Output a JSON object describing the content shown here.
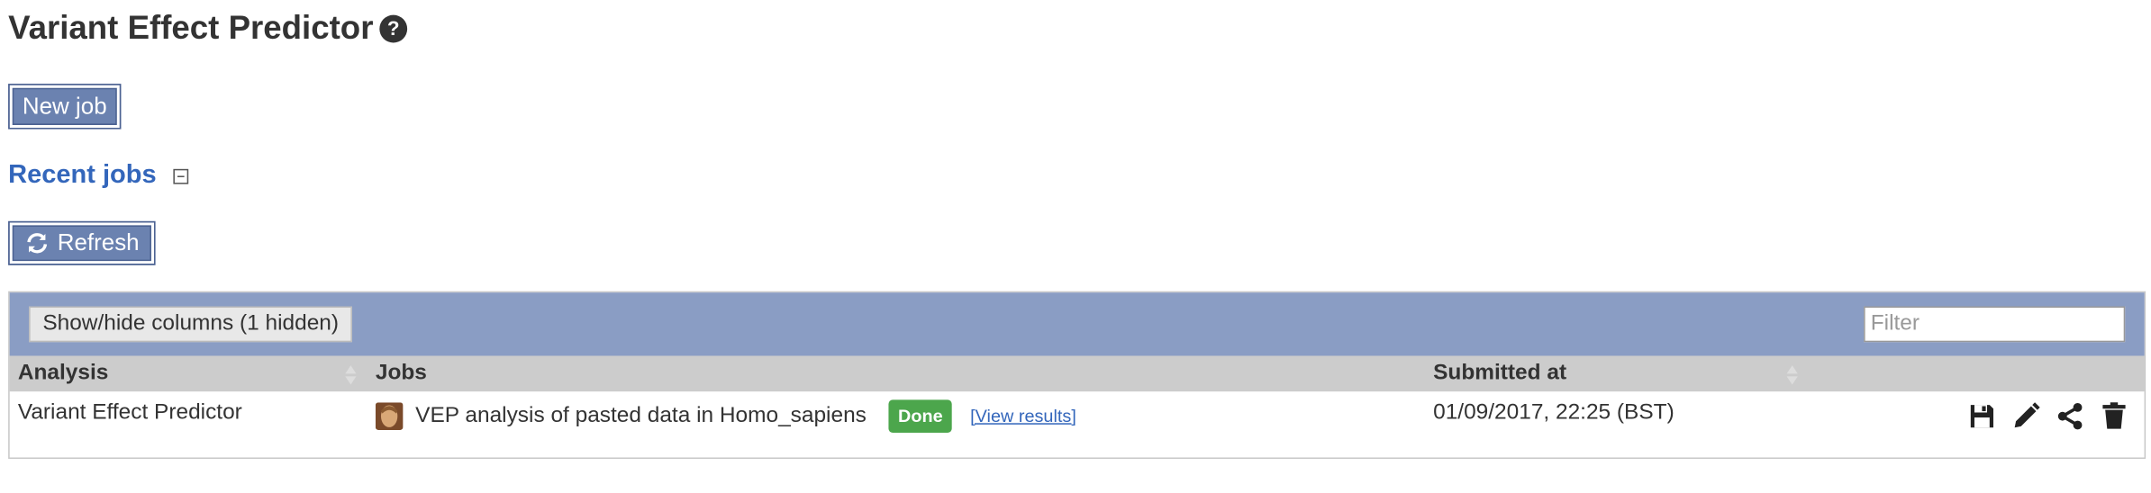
{
  "page": {
    "title": "Variant Effect Predictor",
    "help_icon": "help-circle-icon"
  },
  "buttons": {
    "new_job": "New job",
    "refresh": "Refresh",
    "refresh_icon": "refresh-icon"
  },
  "section": {
    "title": "Recent jobs",
    "toggle_icon": "collapse-icon"
  },
  "table": {
    "show_hide_label": "Show/hide columns (1 hidden)",
    "filter_placeholder": "Filter",
    "columns": [
      "Analysis",
      "Jobs",
      "Submitted at"
    ],
    "rows": [
      {
        "analysis": "Variant Effect Predictor",
        "species_icon": "homo-sapiens-icon",
        "job": "VEP analysis of pasted data in Homo_sapiens",
        "status": "Done",
        "view_link": "[View results]",
        "submitted": "01/09/2017, 22:25 (BST)",
        "actions": [
          "save-icon",
          "edit-icon",
          "share-icon",
          "delete-icon"
        ]
      }
    ]
  },
  "colors": {
    "button": "#6b82b0",
    "toolbar": "#8a9dc4",
    "header": "#cccccc",
    "status_done": "#4ca64c",
    "link": "#3366bb"
  }
}
